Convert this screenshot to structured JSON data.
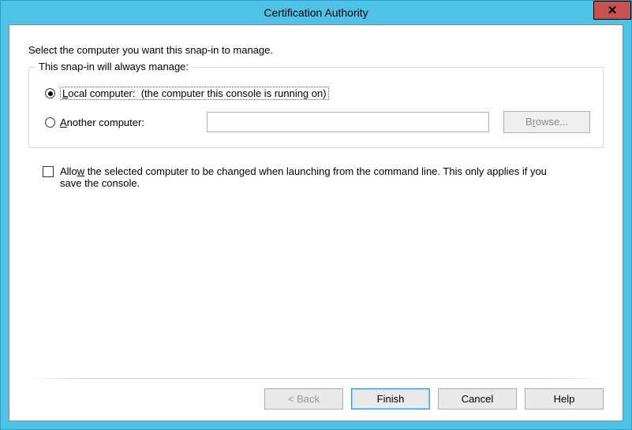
{
  "window": {
    "title": "Certification Authority",
    "close_glyph": "✕"
  },
  "instruction": "Select the computer you want this snap-in to manage.",
  "group": {
    "legend": "This snap-in will always manage:",
    "local_label": "Local computer:  (the computer this console is running on)",
    "another_label": "Another computer:",
    "another_value": "",
    "browse_label": "Browse..."
  },
  "allow_change_label": "Allow the selected computer to be changed when launching from the command line. This only applies if you save the console.",
  "buttons": {
    "back": "< Back",
    "finish": "Finish",
    "cancel": "Cancel",
    "help": "Help"
  }
}
